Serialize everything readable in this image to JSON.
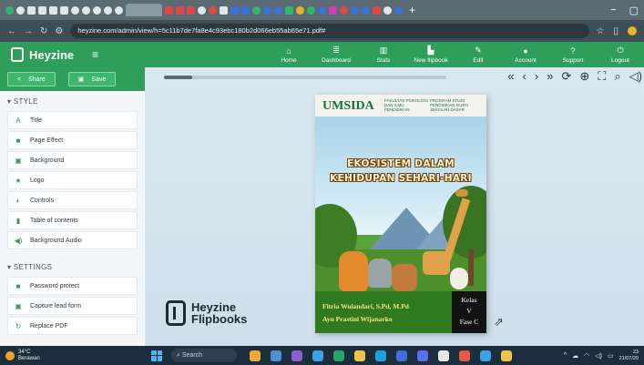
{
  "browser": {
    "window_controls": [
      "−",
      "▢"
    ],
    "url": "heyzine.com/admin/view/h=5c11b7de7fa8e4c93ebc180b2d066eb55ab65e71.pdf#",
    "new_tab": "+"
  },
  "app": {
    "brand": "Heyzine",
    "nav": [
      {
        "label": "Home",
        "icon": "home-icon"
      },
      {
        "label": "Dashboard",
        "icon": "list-icon"
      },
      {
        "label": "Stats",
        "icon": "chart-icon"
      },
      {
        "label": "New flipbook",
        "icon": "book-icon"
      },
      {
        "label": "Edit",
        "icon": "pencil-icon"
      },
      {
        "label": "Account",
        "icon": "user-icon"
      },
      {
        "label": "Support",
        "icon": "question-icon"
      },
      {
        "label": "Logout",
        "icon": "power-icon"
      }
    ]
  },
  "sidebar": {
    "share_label": "Share",
    "save_label": "Save",
    "style_title": "STYLE",
    "style_items": [
      {
        "label": "Title",
        "icon": "A"
      },
      {
        "label": "Page Effect",
        "icon": "■"
      },
      {
        "label": "Background",
        "icon": "▣"
      },
      {
        "label": "Logo",
        "icon": "★"
      },
      {
        "label": "Controls",
        "icon": "◐"
      },
      {
        "label": "Table of contents",
        "icon": "▮"
      },
      {
        "label": "Background Audio",
        "icon": "◀)"
      }
    ],
    "settings_title": "SETTINGS",
    "settings_items": [
      {
        "label": "Password protect",
        "icon": "🔒"
      },
      {
        "label": "Capture lead form",
        "icon": "▣"
      },
      {
        "label": "Replace PDF",
        "icon": "↻"
      }
    ]
  },
  "viewer": {
    "progress_fraction": 0.1,
    "tools": [
      "«",
      "‹",
      "›",
      "»",
      "⟳",
      "⊕",
      "⛶",
      "⌕",
      "◁)"
    ]
  },
  "book": {
    "publisher": "UMSIDA",
    "faculty": "FAKULTAS PSIKOLOGI DAN ILMU PENDIDIKAN",
    "program": "PROGRAM STUDI PENDIDIKAN GURU SEKOLAH DASAR",
    "title_line1": "EKOSISTEM DALAM",
    "title_line2": "KEHIDUPAN SEHARI-HARI",
    "author1": "Fitria Wulandari, S.Pd, M.Pd",
    "author2": "Ayu Prastini Wijanarko",
    "kelas_label": "Kelas",
    "kelas_value": "V",
    "fase": "Fase C"
  },
  "watermark": {
    "line1": "Heyzine",
    "line2": "Flipbooks"
  },
  "taskbar": {
    "weather_temp": "34°C",
    "weather_desc": "Berawan",
    "search": "Search",
    "clock_time": "23",
    "clock_date": "21/07/20"
  }
}
